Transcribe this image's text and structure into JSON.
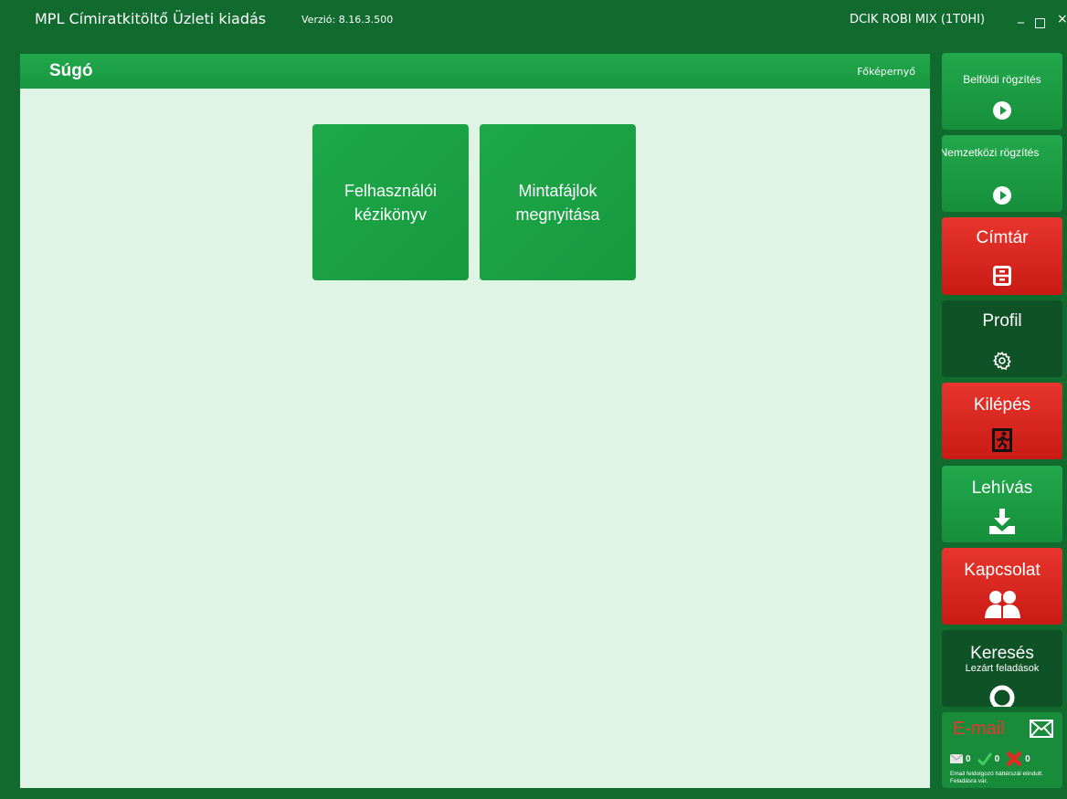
{
  "window": {
    "title": "MPL Címiratkitöltő Üzleti kiadás",
    "version": "Verzió: 8.16.3.500",
    "user": "DCIK ROBI MIX (1T0HI)",
    "minimize": "_",
    "close": "×"
  },
  "panel": {
    "title": "Súgó",
    "home_link": "Főképernyő",
    "tiles": [
      {
        "label": "Felhasználói\nkézikönyv"
      },
      {
        "label": "Mintafájlok\nmegnyitása"
      }
    ]
  },
  "sidebar": {
    "belfoldi": {
      "label": "Belföldi rögzítés",
      "icon": "play-icon"
    },
    "nemzetkozi": {
      "label": "Nemzetközi rögzítés",
      "icon": "play-icon"
    },
    "cimtar": {
      "label": "Címtár",
      "icon": "cabinet-icon"
    },
    "profil": {
      "label": "Profil",
      "icon": "gear-icon"
    },
    "kilepes": {
      "label": "Kilépés",
      "icon": "exit-icon"
    },
    "lehivas": {
      "label": "Lehívás",
      "icon": "download-icon"
    },
    "kapcsolat": {
      "label": "Kapcsolat",
      "icon": "contacts-icon"
    },
    "kereses": {
      "label": "Keresés",
      "sublabel": "Lezárt feladások",
      "icon": "search-icon"
    },
    "email": {
      "label": "E-mail",
      "icon": "envelope-icon",
      "mail_count": "0",
      "ok_count": "0",
      "error_count": "0",
      "status": "Email feldolgozó háttérszál elindult. Feladásra vár."
    }
  },
  "colors": {
    "frame": "#116b2e",
    "panel_bg": "#e0f4e6",
    "green_tile": "#1ea84a",
    "red_tile": "#e8362e",
    "dark_tile": "#0f5225"
  }
}
